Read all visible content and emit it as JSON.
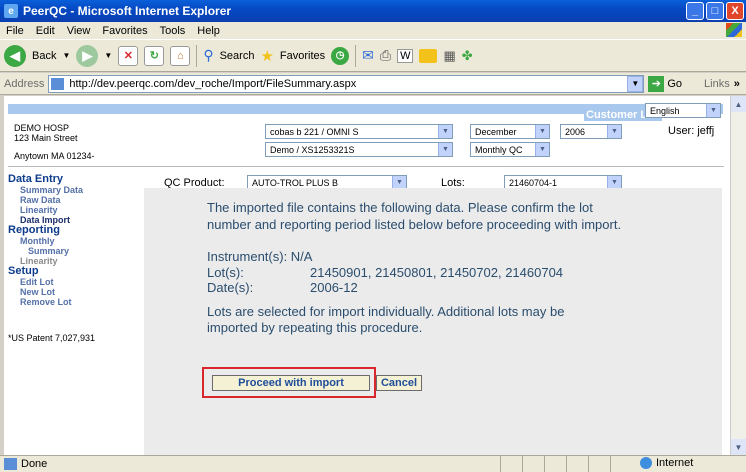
{
  "window": {
    "title": "PeerQC - Microsoft Internet Explorer",
    "minimize": "_",
    "maximize": "□",
    "close": "X"
  },
  "menu": [
    "File",
    "Edit",
    "View",
    "Favorites",
    "Tools",
    "Help"
  ],
  "toolbar": {
    "back": "Back",
    "search": "Search",
    "favorites": "Favorites"
  },
  "address": {
    "label": "Address",
    "url": "http://dev.peerqc.com/dev_roche/Import/FileSummary.aspx",
    "go": "Go",
    "links": "Links",
    "more": "»"
  },
  "header": {
    "customer_list": "Customer List",
    "language": "English",
    "user": "User: jeffj",
    "org_name": "DEMO HOSP",
    "street": "123 Main Street",
    "city": "Anytown MA 01234-",
    "instrument": "cobas b 221 / OMNI S",
    "program": "Demo / XS1253321S",
    "month": "December",
    "year": "2006",
    "period_type": "Monthly QC"
  },
  "nav": {
    "data_entry": "Data Entry",
    "summary_data": "Summary Data",
    "raw_data": "Raw Data",
    "linearity": "Linearity",
    "data_import": "Data Import",
    "reporting": "Reporting",
    "monthly": "Monthly",
    "summary": "Summary",
    "linearity2": "Linearity",
    "setup": "Setup",
    "edit_lot": "Edit Lot",
    "new_lot": "New Lot",
    "remove_lot": "Remove Lot",
    "patent": "*US Patent 7,027,931"
  },
  "qc": {
    "product_label": "QC Product:",
    "product_value": "AUTO-TROL PLUS B",
    "lots_label": "Lots:",
    "lots_value": "21460704-1"
  },
  "message": {
    "intro_line1": "The imported file contains the following data. Please confirm the lot",
    "intro_line2": "number and reporting period listed below before proceeding with import.",
    "instrument": "Instrument(s): N/A",
    "lots_label": "Lot(s):",
    "lots_value": "21450901, 21450801, 21450702, 21460704",
    "dates_label": "Date(s):",
    "dates_value": "2006-12",
    "note_line1": "Lots are selected for import individually. Additional lots may be",
    "note_line2": "imported by repeating this procedure."
  },
  "buttons": {
    "proceed": "Proceed with import",
    "cancel": "Cancel"
  },
  "status": {
    "done": "Done",
    "zone": "Internet"
  },
  "colors": {
    "highlight": "#d9262d",
    "header_band": "#a9c8ee",
    "nav_head": "#0d3c8c"
  }
}
